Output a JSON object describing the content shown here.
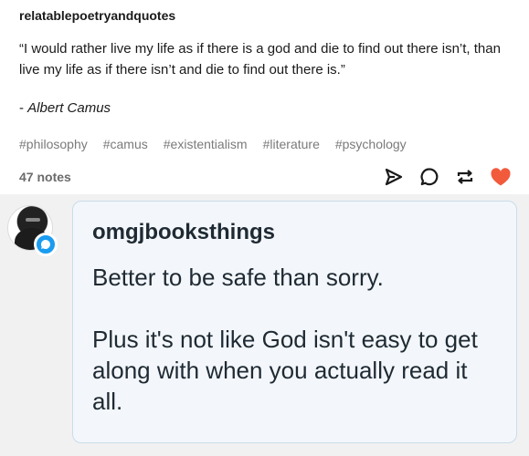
{
  "post": {
    "username": "relatablepoetryandquotes",
    "quote": "“I would rather live my life as if there is a god and die to find out there isn’t, than live my life as if there isn’t and die to find out there is.”",
    "attribution_prefix": "- ",
    "attribution_author": "Albert Camus",
    "tags": [
      "#philosophy",
      "#camus",
      "#existentialism",
      "#literature",
      "#psychology"
    ],
    "notes": "47 notes",
    "actions": {
      "share": "share-icon",
      "reply": "reply-icon",
      "reblog": "reblog-icon",
      "like": "heart-icon"
    },
    "colors": {
      "like": "#f25a3c",
      "icon": "#1a1a1a",
      "badge": "#1a9cf0"
    }
  },
  "reply": {
    "username": "omgjbooksthings",
    "text": "Better to be safe than sorry.\n\nPlus it's not like God isn't easy to get along with when you actually read it all."
  }
}
